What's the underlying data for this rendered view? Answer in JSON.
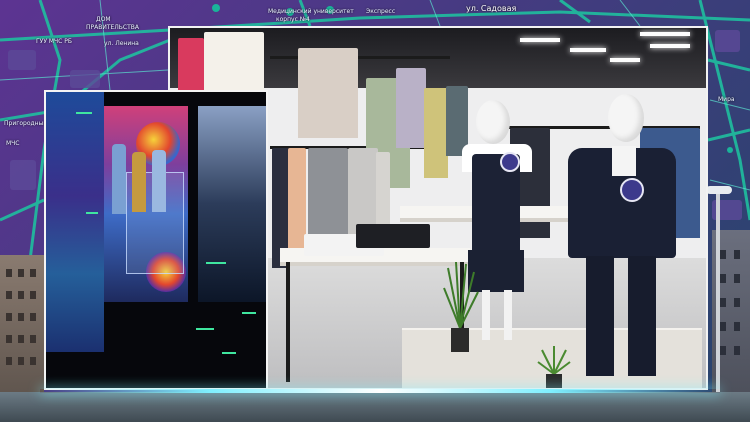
{
  "map": {
    "labels": [
      {
        "text": "ДОМ",
        "name": "map-label-dom"
      },
      {
        "text": "ПРАВИТЕЛЬСТВА",
        "name": "map-label-pravitelstva"
      },
      {
        "text": "ГУУ МЧС РБ",
        "name": "map-label-gu-mchs"
      },
      {
        "text": "ул. Ленина",
        "name": "map-label-lenina"
      },
      {
        "text": "Медицинский университет",
        "name": "map-label-med-univer"
      },
      {
        "text": "корпус №4",
        "name": "map-label-korpus"
      },
      {
        "text": "Экспресс",
        "name": "map-label-express"
      },
      {
        "text": "ул. Садовая",
        "name": "map-label-sadovaya"
      },
      {
        "text": "Пригородный вокзал",
        "name": "map-label-vokzal"
      },
      {
        "text": "МЧС",
        "name": "map-label-mchs"
      },
      {
        "text": "Мира",
        "name": "map-label-mira"
      }
    ]
  },
  "colors": {
    "map_base": "#3b2a68",
    "road": "#23c3a8",
    "glow": "#7ff0ff",
    "badge": "#3d3a8c",
    "studio_green": "#3fe6a0"
  },
  "photos": {
    "main": {
      "subject": "clothing-store-mannequins"
    },
    "inset": {
      "subject": "tv-studio-weather-screens"
    }
  }
}
